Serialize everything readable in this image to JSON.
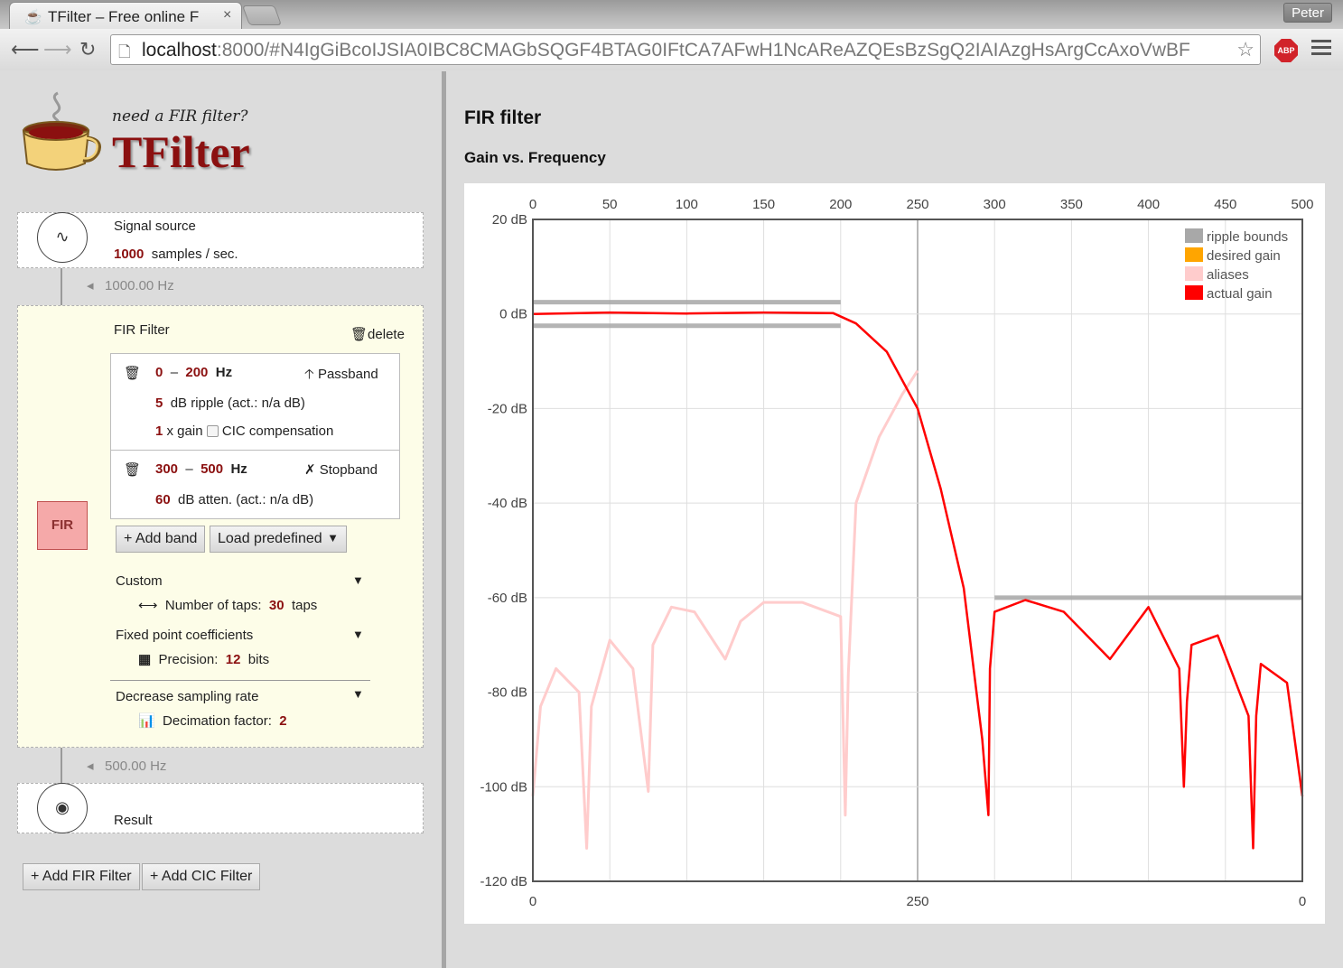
{
  "browser": {
    "tab_title": "TFilter – Free online F",
    "tab_close": "×",
    "user": "Peter",
    "url_host": "localhost",
    "url_rest": ":8000/#N4IgGiBcoIJSIA0IBC8CMAGbSQGF4BTAG0IFtCA7AFwH1NcAReAZQEsBzSgQ2IAIAzgHsArgCcAxoVwBF",
    "abp": "ABP"
  },
  "logo": {
    "tagline": "need a FIR filter?",
    "name": "TFilter"
  },
  "signal_source": {
    "title": "Signal source",
    "rate": "1000",
    "rate_unit": "samples / sec.",
    "freq": "1000.00 Hz"
  },
  "fir": {
    "title": "FIR Filter",
    "delete": "delete",
    "block_label": "FIR",
    "passband": {
      "from": "0",
      "dash": "–",
      "to": "200",
      "unit": "Hz",
      "type": "Passband",
      "ripple": "5",
      "ripple_text": "dB ripple (act.: n/a dB)",
      "gain": "1",
      "gain_text": "x gain",
      "cic_label": "CIC compensation"
    },
    "stopband": {
      "from": "300",
      "dash": "–",
      "to": "500",
      "unit": "Hz",
      "type": "Stopband",
      "atten": "60",
      "atten_text": "dB atten. (act.: n/a dB)"
    },
    "add_band": "+ Add band",
    "load_predefined": "Load predefined",
    "dropdown_arrow": "▼",
    "custom": "Custom",
    "taps_label": "Number of taps:",
    "taps_value": "30",
    "taps_unit": "taps",
    "fixed_point": "Fixed point coefficients",
    "precision_label": "Precision:",
    "precision_value": "12",
    "precision_unit": "bits",
    "decrease": "Decrease sampling rate",
    "decimation_label": "Decimation factor:",
    "decimation_value": "2",
    "out_freq": "500.00 Hz"
  },
  "result": {
    "title": "Result"
  },
  "buttons": {
    "add_fir": "+ Add FIR Filter",
    "add_cic": "+ Add CIC Filter"
  },
  "right": {
    "title": "FIR filter",
    "subtitle": "Gain vs. Frequency"
  },
  "colors": {
    "ripple": "#a8a8a8",
    "desired": "#ffa500",
    "aliases": "#ffcccc",
    "actual": "#ff0000",
    "brand": "#8b1010"
  },
  "chart_data": {
    "type": "line",
    "x_top_ticks": [
      "0",
      "50",
      "100",
      "150",
      "200",
      "250",
      "300",
      "350",
      "400",
      "450",
      "500"
    ],
    "x_bottom_ticks": [
      "0",
      "250",
      "0"
    ],
    "y_ticks": [
      "20 dB",
      "0 dB",
      "-20 dB",
      "-40 dB",
      "-60 dB",
      "-80 dB",
      "-100 dB",
      "-120 dB"
    ],
    "xlim": [
      0,
      500
    ],
    "ylim": [
      -120,
      20
    ],
    "legend": [
      "ripple bounds",
      "desired gain",
      "aliases",
      "actual gain"
    ],
    "legend_position": "top-right",
    "grid": true,
    "ripple_bounds": [
      {
        "x": [
          0,
          200
        ],
        "y": [
          2.5,
          2.5
        ]
      },
      {
        "x": [
          0,
          200
        ],
        "y": [
          -2.5,
          -2.5
        ]
      },
      {
        "x": [
          300,
          500
        ],
        "y": [
          -60,
          -60
        ]
      }
    ],
    "actual_gain": {
      "x": [
        0,
        50,
        100,
        150,
        195,
        210,
        230,
        250,
        265,
        280,
        292,
        296,
        297,
        300,
        320,
        345,
        375,
        400,
        420,
        423,
        425,
        428,
        445,
        465,
        468,
        470,
        473,
        490,
        500
      ],
      "y": [
        0,
        0.3,
        0.1,
        0.3,
        0.2,
        -2,
        -8,
        -20,
        -37,
        -58,
        -90,
        -106,
        -75,
        -63,
        -60.5,
        -63,
        -73,
        -62,
        -75,
        -100,
        -82,
        -70,
        -68,
        -85,
        -113,
        -85,
        -74,
        -78,
        -102
      ]
    },
    "aliases": {
      "x": [
        0,
        5,
        15,
        30,
        35,
        38,
        50,
        65,
        75,
        78,
        90,
        105,
        125,
        135,
        150,
        175,
        200,
        203,
        205,
        210,
        225,
        240,
        250
      ],
      "y": [
        -102,
        -83,
        -75,
        -80,
        -113,
        -83,
        -69,
        -75,
        -101,
        -70,
        -62,
        -63,
        -73,
        -65,
        -61,
        -61,
        -64,
        -106,
        -76,
        -40,
        -26,
        -17,
        -12
      ]
    }
  }
}
